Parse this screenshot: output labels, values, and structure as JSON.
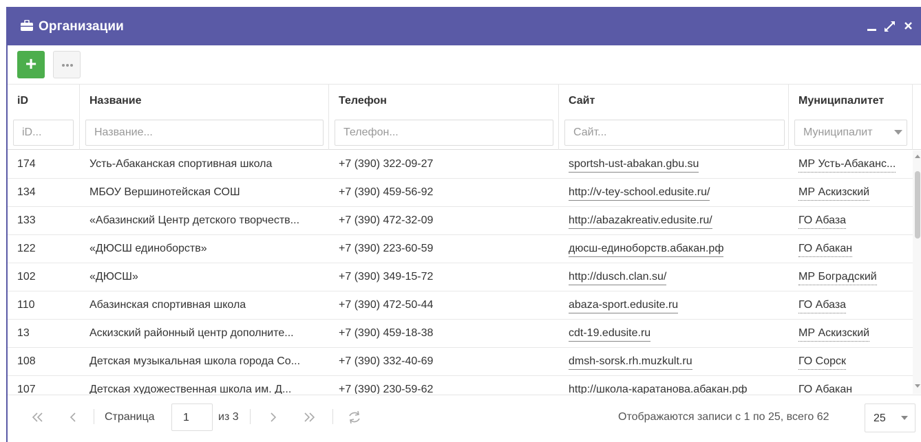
{
  "window": {
    "title": "Организации",
    "title_icon": "briefcase-icon",
    "controls": [
      "minimize-icon",
      "maximize-icon",
      "close-icon"
    ],
    "header_color": "#5a5aa6"
  },
  "toolbar": {
    "add_label": "+",
    "add_color": "#4cae4c",
    "more_icon": "ellipsis-icon"
  },
  "grid": {
    "columns": [
      {
        "label": "iD",
        "filter_placeholder": "iD..."
      },
      {
        "label": "Название",
        "filter_placeholder": "Название..."
      },
      {
        "label": "Телефон",
        "filter_placeholder": "Телефон..."
      },
      {
        "label": "Сайт",
        "filter_placeholder": "Сайт..."
      },
      {
        "label": "Муниципалитет",
        "filter_placeholder": "Муниципалит"
      }
    ],
    "rows": [
      {
        "id": "174",
        "name": "Усть-Абаканская спортивная школа",
        "phone": "+7 (390) 322-09-27",
        "site": "sportsh-ust-abakan.gbu.su",
        "municipality": "МР Усть-Абаканс..."
      },
      {
        "id": "134",
        "name": "МБОУ Вершинотейская СОШ",
        "phone": "+7 (390) 459-56-92",
        "site": "http://v-tey-school.edusite.ru/",
        "municipality": "МР Аскизский"
      },
      {
        "id": "133",
        "name": "«Абазинский Центр детского творчеств...",
        "phone": "+7 (390) 472-32-09",
        "site": "http://abazakreativ.edusite.ru/",
        "municipality": "ГО Абаза"
      },
      {
        "id": "122",
        "name": "«ДЮСШ единоборств»",
        "phone": "+7 (390) 223-60-59",
        "site": "дюсш-единоборств.абакан.рф",
        "municipality": "ГО Абакан"
      },
      {
        "id": "102",
        "name": "«ДЮСШ»",
        "phone": "+7 (390) 349-15-72",
        "site": "http://dusch.clan.su/",
        "municipality": "МР Боградский"
      },
      {
        "id": "110",
        "name": "Абазинская спортивная школа",
        "phone": "+7 (390) 472-50-44",
        "site": "abaza-sport.edusite.ru",
        "municipality": "ГО Абаза"
      },
      {
        "id": "13",
        "name": "Аскизский районный центр дополните...",
        "phone": "+7 (390) 459-18-38",
        "site": "cdt-19.edusite.ru",
        "municipality": "МР Аскизский"
      },
      {
        "id": "108",
        "name": "Детская музыкальная школа города Со...",
        "phone": "+7 (390) 332-40-69",
        "site": "dmsh-sorsk.rh.muzkult.ru",
        "municipality": "ГО Сорск"
      },
      {
        "id": "107",
        "name": "Детская художественная школа им. Д...",
        "phone": "+7 (390) 230-59-62",
        "site": "http://школа-каратанова.абакан.рф",
        "municipality": "ГО Абакан"
      }
    ]
  },
  "pager": {
    "page_label": "Страница",
    "page_value": "1",
    "of_label": "из 3",
    "summary": "Отображаются записи с 1 по 25, всего 62",
    "page_size": "25",
    "icons": [
      "first-page-icon",
      "prev-page-icon",
      "next-page-icon",
      "last-page-icon",
      "refresh-icon"
    ]
  }
}
